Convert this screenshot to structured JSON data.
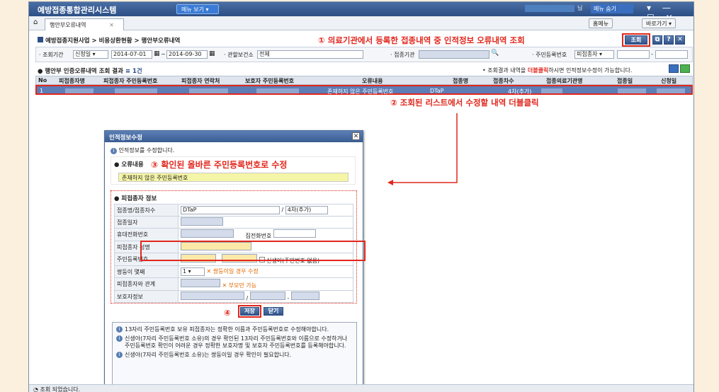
{
  "app": {
    "title": "예방접종통합관리시스템",
    "menu_view": "메뉴 보기 ▾",
    "user_suffix": "님",
    "menu_hide": "메뉴 숨기",
    "window_buttons": "▾ — ☐ ✕"
  },
  "tabs": {
    "home_icon": "home-icon",
    "active": "행안부오류내역",
    "close": "✕",
    "right_buttons": [
      "홈메뉴",
      "바로가기 ▾"
    ]
  },
  "breadcrumb": "예방접종지원사업 > 비용상환현황 > 행안부오류내역",
  "notes": {
    "n1": "① 의료기관에서 등록한 접종내역 중 인적정보 오류내역 조회",
    "n2": "② 조회된 리스트에서 수정할 내역 더블클릭",
    "n3": "③ 확인된 올바른 주민등록번호로 수정",
    "n4": "④"
  },
  "toolbar": {
    "search_btn": "조회",
    "icons": [
      "⧉",
      "?",
      "✕"
    ]
  },
  "search": {
    "period_label": "· 조회기간",
    "period_type": "신청일 ▾",
    "date_from": "2014-07-01",
    "tilde": "~",
    "date_to": "2014-09-30",
    "center_label": "· 관할보건소",
    "center_value": "전체",
    "org_label": "· 접종기관",
    "rrn_label": "· 주민등록번호",
    "rrn_type": "피접종자 ▾"
  },
  "grid": {
    "title": "행안부 인증오류내역 조회 결과",
    "count": "≡ 1건",
    "hint_pre": "• 조회결과 내역을 ",
    "hint_em": "더블클릭",
    "hint_post": "하시면 인적정보수정이 가능합니다.",
    "headers": [
      "No",
      "피접종자명",
      "피접종자 주민등록번호",
      "피접종자 연락처",
      "보호자 주민등록번호",
      "오류내용",
      "접종명",
      "접종차수",
      "접종의료기관명",
      "접종일",
      "신청일"
    ],
    "row": {
      "no": "1",
      "error": "존재하지 않은 주민등록번호",
      "vaccine": "DTaP",
      "dose": "4차(추가)"
    }
  },
  "dialog": {
    "title": "인적정보수정",
    "close": "✕",
    "intro": "인적정보를 수정합니다.",
    "err_label": "오류내용",
    "err_value": "존재하지 않은 주민등록번호",
    "person_section": "피접종자 정보",
    "rows": {
      "vaccine_dose": "접종명/접종차수",
      "vaccine_value": "DTaP",
      "dose_value": "4차(추가)",
      "date": "접종일자",
      "mobile": "휴대전화번호",
      "home_phone": "집전화번호",
      "name": "피접종자 성명",
      "rrn": "주민등록번호",
      "newborn": "신생아(주민번호 없음)",
      "twins": "쌍둥이 몇째",
      "twins_value": "1 ▾",
      "twins_note": "✕ 쌍둥이일 경우 수정",
      "relation": "피접종자와 관계",
      "relation_note": "✕ 부모만 가능",
      "guardian": "보호자정보"
    },
    "save": "저장",
    "close_btn": "닫기",
    "info": [
      "13자리 주민등록번호 보유 피접종자는 정확한 이름과 주민등록번호로 수정해야합니다.",
      "신생아(7자리 주민등록번호 소유)의 경우 확인된 13자리 주민등록번호와 이름으로 수정하거나 주민등록번호 확인이 어려운 경우 정확한 보호자명 및 보호자 주민등록번호를 등록해야합니다.",
      "신생아(7자리 주민등록번호 소유)는 쌍둥이일 경우 확인이 필요합니다."
    ]
  },
  "status": "조회 되었습니다.",
  "colors": {
    "red": "#e1261c",
    "selected_row": "#5d7db6",
    "title_bar": "#2c4f85"
  }
}
